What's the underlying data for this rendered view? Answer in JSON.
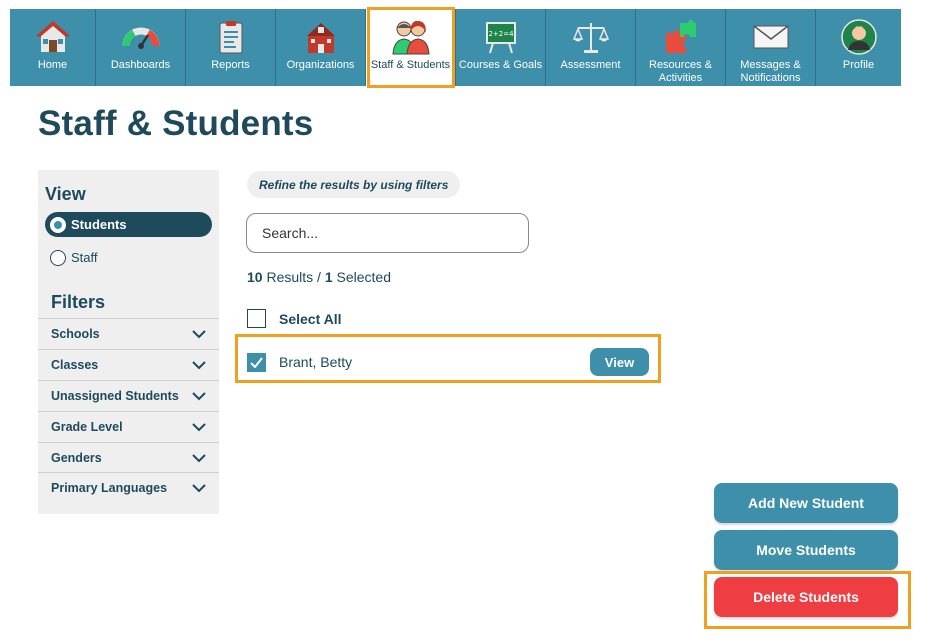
{
  "nav": {
    "items": [
      {
        "label": "Home",
        "icon": "house-icon"
      },
      {
        "label": "Dashboards",
        "icon": "gauge-icon"
      },
      {
        "label": "Reports",
        "icon": "report-icon"
      },
      {
        "label": "Organizations",
        "icon": "school-building-icon"
      },
      {
        "label": "Staff & Students",
        "icon": "people-icon"
      },
      {
        "label": "Courses & Goals",
        "icon": "chalkboard-icon"
      },
      {
        "label": "Assessment",
        "icon": "scales-icon"
      },
      {
        "label": "Resources &\nActivities",
        "icon": "puzzle-icon"
      },
      {
        "label": "Messages &\nNotifications",
        "icon": "envelope-icon"
      },
      {
        "label": "Profile",
        "icon": "profile-icon"
      }
    ],
    "active": "Staff & Students"
  },
  "page": {
    "title": "Staff & Students"
  },
  "sidebar": {
    "view_heading": "View",
    "view_options": [
      {
        "label": "Students",
        "selected": true
      },
      {
        "label": "Staff",
        "selected": false
      }
    ],
    "filters_heading": "Filters",
    "filters": [
      "Schools",
      "Classes",
      "Unassigned Students",
      "Grade Level",
      "Genders",
      "Primary Languages"
    ]
  },
  "main": {
    "hint": "Refine the results by using filters",
    "search_placeholder": "Search...",
    "results_count": "10",
    "results_label": "Results /",
    "selected_count": "1",
    "selected_label": "Selected",
    "select_all_label": "Select All",
    "students": [
      {
        "name": "Brant, Betty",
        "checked": true,
        "view_label": "View"
      }
    ]
  },
  "actions": {
    "add": "Add New Student",
    "move": "Move Students",
    "delete": "Delete Students"
  },
  "colors": {
    "nav_bg": "#3e90aa",
    "primary_text": "#1f4a5c",
    "delete_red": "#ef3e42",
    "highlight": "#f0a020"
  }
}
